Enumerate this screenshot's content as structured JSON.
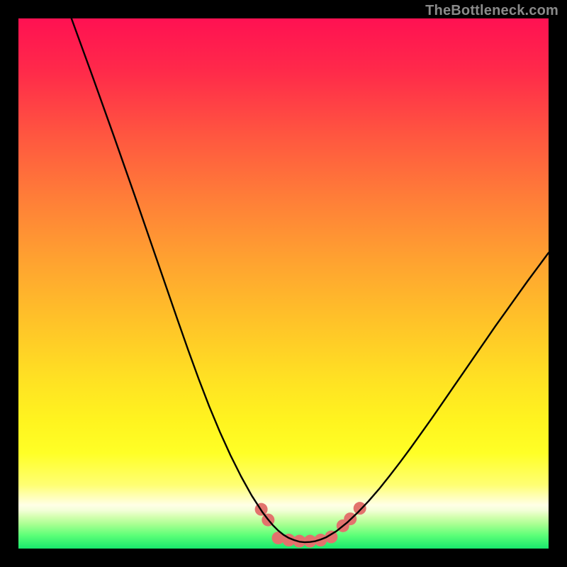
{
  "watermark": "TheBottleneck.com",
  "chart_data": {
    "type": "line",
    "title": "",
    "xlabel": "",
    "ylabel": "",
    "xlim": [
      0,
      100
    ],
    "ylim": [
      0,
      100
    ],
    "background_gradient_stops": [
      {
        "offset": 0.0,
        "color": "#ff1152"
      },
      {
        "offset": 0.1,
        "color": "#ff2a4a"
      },
      {
        "offset": 0.22,
        "color": "#ff5640"
      },
      {
        "offset": 0.34,
        "color": "#ff7e38"
      },
      {
        "offset": 0.46,
        "color": "#ffa330"
      },
      {
        "offset": 0.58,
        "color": "#ffc528"
      },
      {
        "offset": 0.68,
        "color": "#ffe123"
      },
      {
        "offset": 0.76,
        "color": "#fff41f"
      },
      {
        "offset": 0.82,
        "color": "#ffff26"
      },
      {
        "offset": 0.88,
        "color": "#ffff73"
      },
      {
        "offset": 0.905,
        "color": "#ffffc0"
      },
      {
        "offset": 0.918,
        "color": "#ffffe6"
      },
      {
        "offset": 0.928,
        "color": "#f3ffd8"
      },
      {
        "offset": 0.94,
        "color": "#d4ffb0"
      },
      {
        "offset": 0.955,
        "color": "#a6ff90"
      },
      {
        "offset": 0.975,
        "color": "#5cff78"
      },
      {
        "offset": 1.0,
        "color": "#18e86c"
      }
    ],
    "series": [
      {
        "name": "bottleneck-curve",
        "color": "#000000",
        "stroke_width": 2.4,
        "x": [
          10.0,
          12.0,
          14.0,
          16.0,
          18.0,
          20.0,
          22.0,
          24.0,
          26.0,
          28.0,
          30.0,
          32.0,
          34.0,
          36.0,
          38.0,
          40.0,
          42.0,
          44.0,
          46.0,
          47.0,
          48.0,
          49.0,
          50.0,
          51.0,
          52.0,
          53.0,
          54.0,
          55.0,
          56.0,
          57.0,
          58.0,
          60.0,
          62.0,
          64.0,
          66.0,
          68.0,
          70.0,
          72.0,
          74.0,
          76.0,
          78.0,
          80.0,
          82.0,
          84.0,
          86.0,
          88.0,
          90.0,
          92.0,
          94.0,
          96.0,
          98.0,
          100.0
        ],
        "y": [
          100.0,
          94.5,
          89.0,
          83.4,
          77.8,
          72.1,
          66.4,
          60.6,
          54.8,
          49.0,
          43.2,
          37.5,
          32.0,
          26.8,
          22.0,
          17.6,
          13.6,
          10.0,
          6.9,
          5.6,
          4.4,
          3.4,
          2.6,
          2.0,
          1.6,
          1.3,
          1.2,
          1.25,
          1.4,
          1.7,
          2.1,
          3.3,
          4.9,
          6.8,
          8.9,
          11.2,
          13.7,
          16.3,
          19.0,
          21.8,
          24.6,
          27.5,
          30.4,
          33.3,
          36.2,
          39.1,
          42.0,
          44.8,
          47.6,
          50.4,
          53.1,
          55.8
        ]
      }
    ],
    "markers": {
      "name": "highlight-dots",
      "color": "#e2726d",
      "approx_radius": 9,
      "points": [
        {
          "x": 45.8,
          "y": 7.4
        },
        {
          "x": 47.1,
          "y": 5.4
        },
        {
          "x": 49.0,
          "y": 2.0
        },
        {
          "x": 51.0,
          "y": 1.6
        },
        {
          "x": 53.0,
          "y": 1.4
        },
        {
          "x": 55.0,
          "y": 1.4
        },
        {
          "x": 57.0,
          "y": 1.6
        },
        {
          "x": 59.0,
          "y": 2.2
        },
        {
          "x": 61.2,
          "y": 4.3
        },
        {
          "x": 62.6,
          "y": 5.6
        },
        {
          "x": 64.4,
          "y": 7.6
        }
      ]
    }
  }
}
